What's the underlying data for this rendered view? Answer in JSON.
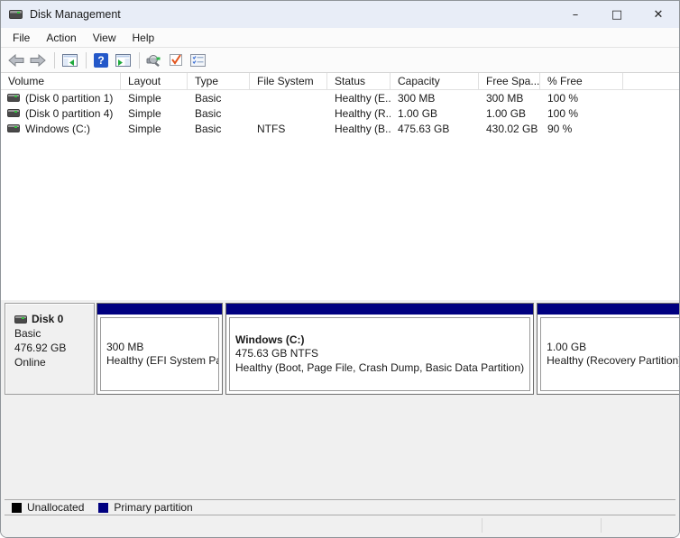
{
  "window": {
    "title": "Disk Management",
    "controls": {
      "minimize": "–",
      "maximize": "□",
      "close": "✕"
    }
  },
  "menu": {
    "items": [
      "File",
      "Action",
      "View",
      "Help"
    ]
  },
  "toolbar": {
    "icons": [
      "back-icon",
      "forward-icon",
      "show-console-tree-icon",
      "help-icon",
      "show-action-pane-icon",
      "rescan-disks-icon",
      "check-status-icon",
      "properties-list-icon"
    ],
    "help_glyph": "?"
  },
  "table": {
    "columns": [
      "Volume",
      "Layout",
      "Type",
      "File System",
      "Status",
      "Capacity",
      "Free Spa...",
      "% Free",
      ""
    ],
    "rows": [
      {
        "volume": "(Disk 0 partition 1)",
        "layout": "Simple",
        "type": "Basic",
        "file_system": "",
        "status": "Healthy (E...",
        "capacity": "300 MB",
        "free_space": "300 MB",
        "pct_free": "100 %"
      },
      {
        "volume": "(Disk 0 partition 4)",
        "layout": "Simple",
        "type": "Basic",
        "file_system": "",
        "status": "Healthy (R...",
        "capacity": "1.00 GB",
        "free_space": "1.00 GB",
        "pct_free": "100 %"
      },
      {
        "volume": "Windows (C:)",
        "layout": "Simple",
        "type": "Basic",
        "file_system": "NTFS",
        "status": "Healthy (B...",
        "capacity": "475.63 GB",
        "free_space": "430.02 GB",
        "pct_free": "90 %"
      }
    ]
  },
  "disk_view": {
    "disk0": {
      "label": "Disk 0",
      "type": "Basic",
      "size": "476.92 GB",
      "status": "Online"
    },
    "partitions": [
      {
        "title": "",
        "size_line": "300 MB",
        "status_line": "Healthy (EFI System Parti"
      },
      {
        "title": "Windows  (C:)",
        "size_line": "475.63 GB NTFS",
        "status_line": "Healthy (Boot, Page File, Crash Dump, Basic Data Partition)"
      },
      {
        "title": "",
        "size_line": "1.00 GB",
        "status_line": "Healthy (Recovery Partition)"
      }
    ]
  },
  "legend": {
    "items": [
      {
        "label": "Unallocated",
        "color": "#000000"
      },
      {
        "label": "Primary partition",
        "color": "#000080"
      }
    ]
  },
  "colors": {
    "primary_partition": "#000080",
    "unallocated": "#000000",
    "titlebar_bg": "#e8edf7",
    "pane_bg": "#f0f0f0"
  }
}
